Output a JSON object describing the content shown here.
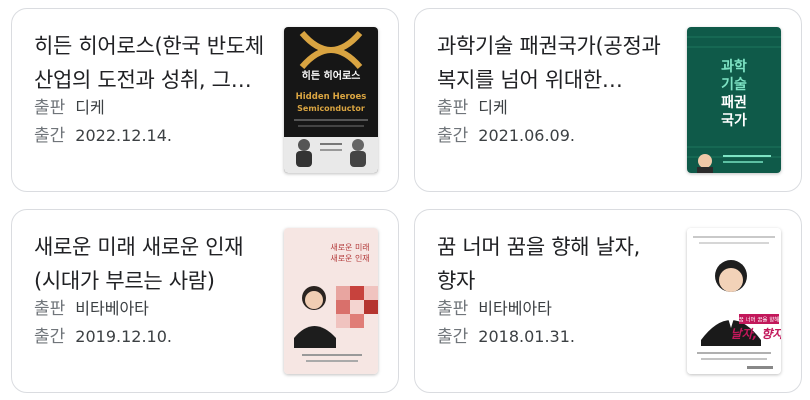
{
  "books": [
    {
      "title": "히든 히어로스(한국 반도체 산업의 도전과 성취, 그 위대한 여정)",
      "publisher_label": "출판",
      "publisher": "디케",
      "date_label": "출간",
      "date": "2022.12.14.",
      "cover_title": "히든 히어로스",
      "cover_en_1": "Hidden Heroes",
      "cover_en_2": "Semiconductor"
    },
    {
      "title": "과학기술 패권국가(공정과 복지를 넘어 위대한 대한민국으로)",
      "publisher_label": "출판",
      "publisher": "디케",
      "date_label": "출간",
      "date": "2021.06.09.",
      "cover_title_1": "과학",
      "cover_title_2": "기술",
      "cover_title_3": "패권",
      "cover_title_4": "국가"
    },
    {
      "title": "새로운 미래 새로운 인재(시대가 부르는 사람)",
      "publisher_label": "출판",
      "publisher": "비타베아타",
      "date_label": "출간",
      "date": "2019.12.10.",
      "cover_title_1": "새로운 미래",
      "cover_title_2": "새로운 인재"
    },
    {
      "title": "꿈 너머 꿈을 향해 날자, 향자",
      "publisher_label": "출판",
      "publisher": "비타베아타",
      "date_label": "출간",
      "date": "2018.01.31.",
      "cover_sub": "꿈 너머 꿈을 향해",
      "cover_title": "날자, 향자"
    }
  ],
  "colors": {
    "card_border": "#dadce0",
    "title": "#202124",
    "meta_label": "#70757a",
    "cover1_bg": "#1a1a1a",
    "cover1_accent": "#d9a441",
    "cover2_bg": "#0f5a49",
    "cover2_accent": "#7ee3c4",
    "cover3_bg": "#f4e2e0",
    "cover3_accent": "#c7423d",
    "cover4_bg": "#ffffff",
    "cover4_accent": "#c2185b"
  }
}
